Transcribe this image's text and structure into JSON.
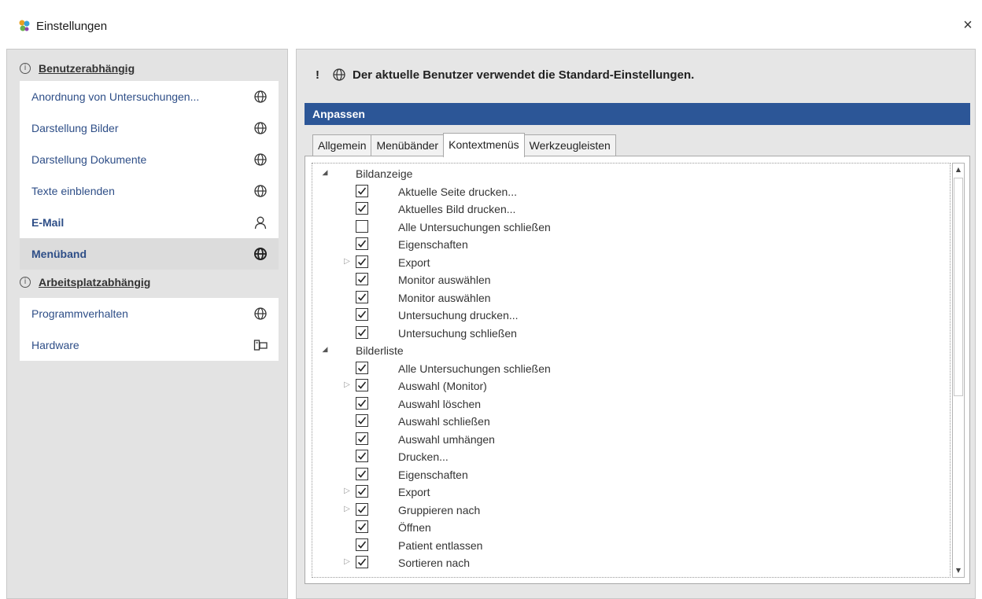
{
  "window": {
    "title": "Einstellungen",
    "close_glyph": "×",
    "app_icon": "app-logo-icon"
  },
  "sidebar": {
    "groups": [
      {
        "title": "Benutzerabhängig",
        "info_glyph": "i",
        "items": [
          {
            "label": "Anordnung von Untersuchungen...",
            "icon": "globe-icon",
            "bold": false,
            "selected": false
          },
          {
            "label": "Darstellung Bilder",
            "icon": "globe-icon",
            "bold": false,
            "selected": false
          },
          {
            "label": "Darstellung Dokumente",
            "icon": "globe-icon",
            "bold": false,
            "selected": false
          },
          {
            "label": "Texte einblenden",
            "icon": "globe-icon",
            "bold": false,
            "selected": false
          },
          {
            "label": "E-Mail",
            "icon": "user-icon",
            "bold": true,
            "selected": false
          },
          {
            "label": "Menüband",
            "icon": "globe-icon",
            "bold": true,
            "selected": true
          }
        ]
      },
      {
        "title": "Arbeitsplatzabhängig",
        "info_glyph": "i",
        "items": [
          {
            "label": "Programmverhalten",
            "icon": "globe-icon",
            "bold": false,
            "selected": false
          },
          {
            "label": "Hardware",
            "icon": "computer-icon",
            "bold": false,
            "selected": false
          }
        ]
      }
    ]
  },
  "main": {
    "notice_mark": "!",
    "notice": "Der aktuelle Benutzer verwendet die Standard-Einstellungen.",
    "section_title": "Anpassen",
    "tabs": [
      {
        "label": "Allgemein",
        "active": false
      },
      {
        "label": "Menübänder",
        "active": false
      },
      {
        "label": "Kontextmenüs",
        "active": true
      },
      {
        "label": "Werkzeugleisten",
        "active": false
      }
    ],
    "tree": [
      {
        "type": "group",
        "label": "Bildanzeige",
        "expanded": true
      },
      {
        "type": "item",
        "label": "Aktuelle Seite drucken...",
        "checked": true,
        "has_children": false
      },
      {
        "type": "item",
        "label": "Aktuelles Bild drucken...",
        "checked": true,
        "has_children": false
      },
      {
        "type": "item",
        "label": "Alle Untersuchungen schließen",
        "checked": false,
        "has_children": false
      },
      {
        "type": "item",
        "label": "Eigenschaften",
        "checked": true,
        "has_children": false
      },
      {
        "type": "item",
        "label": "Export",
        "checked": true,
        "has_children": true
      },
      {
        "type": "item",
        "label": "Monitor auswählen",
        "checked": true,
        "has_children": false
      },
      {
        "type": "item",
        "label": "Monitor auswählen",
        "checked": true,
        "has_children": false
      },
      {
        "type": "item",
        "label": "Untersuchung drucken...",
        "checked": true,
        "has_children": false
      },
      {
        "type": "item",
        "label": "Untersuchung schließen",
        "checked": true,
        "has_children": false
      },
      {
        "type": "group",
        "label": "Bilderliste",
        "expanded": true
      },
      {
        "type": "item",
        "label": "Alle Untersuchungen schließen",
        "checked": true,
        "has_children": false
      },
      {
        "type": "item",
        "label": "Auswahl (Monitor)",
        "checked": true,
        "has_children": true
      },
      {
        "type": "item",
        "label": "Auswahl löschen",
        "checked": true,
        "has_children": false
      },
      {
        "type": "item",
        "label": "Auswahl schließen",
        "checked": true,
        "has_children": false
      },
      {
        "type": "item",
        "label": "Auswahl umhängen",
        "checked": true,
        "has_children": false
      },
      {
        "type": "item",
        "label": "Drucken...",
        "checked": true,
        "has_children": false
      },
      {
        "type": "item",
        "label": "Eigenschaften",
        "checked": true,
        "has_children": false
      },
      {
        "type": "item",
        "label": "Export",
        "checked": true,
        "has_children": true
      },
      {
        "type": "item",
        "label": "Gruppieren nach",
        "checked": true,
        "has_children": true
      },
      {
        "type": "item",
        "label": "Öffnen",
        "checked": true,
        "has_children": false
      },
      {
        "type": "item",
        "label": "Patient entlassen",
        "checked": true,
        "has_children": false
      },
      {
        "type": "item",
        "label": "Sortieren nach",
        "checked": true,
        "has_children": true
      }
    ],
    "scrollbar": {
      "up_glyph": "▲",
      "down_glyph": "▼"
    }
  },
  "colors": {
    "accent": "#2c5697",
    "link": "#2e4e87",
    "pane_bg": "#e3e3e3"
  }
}
